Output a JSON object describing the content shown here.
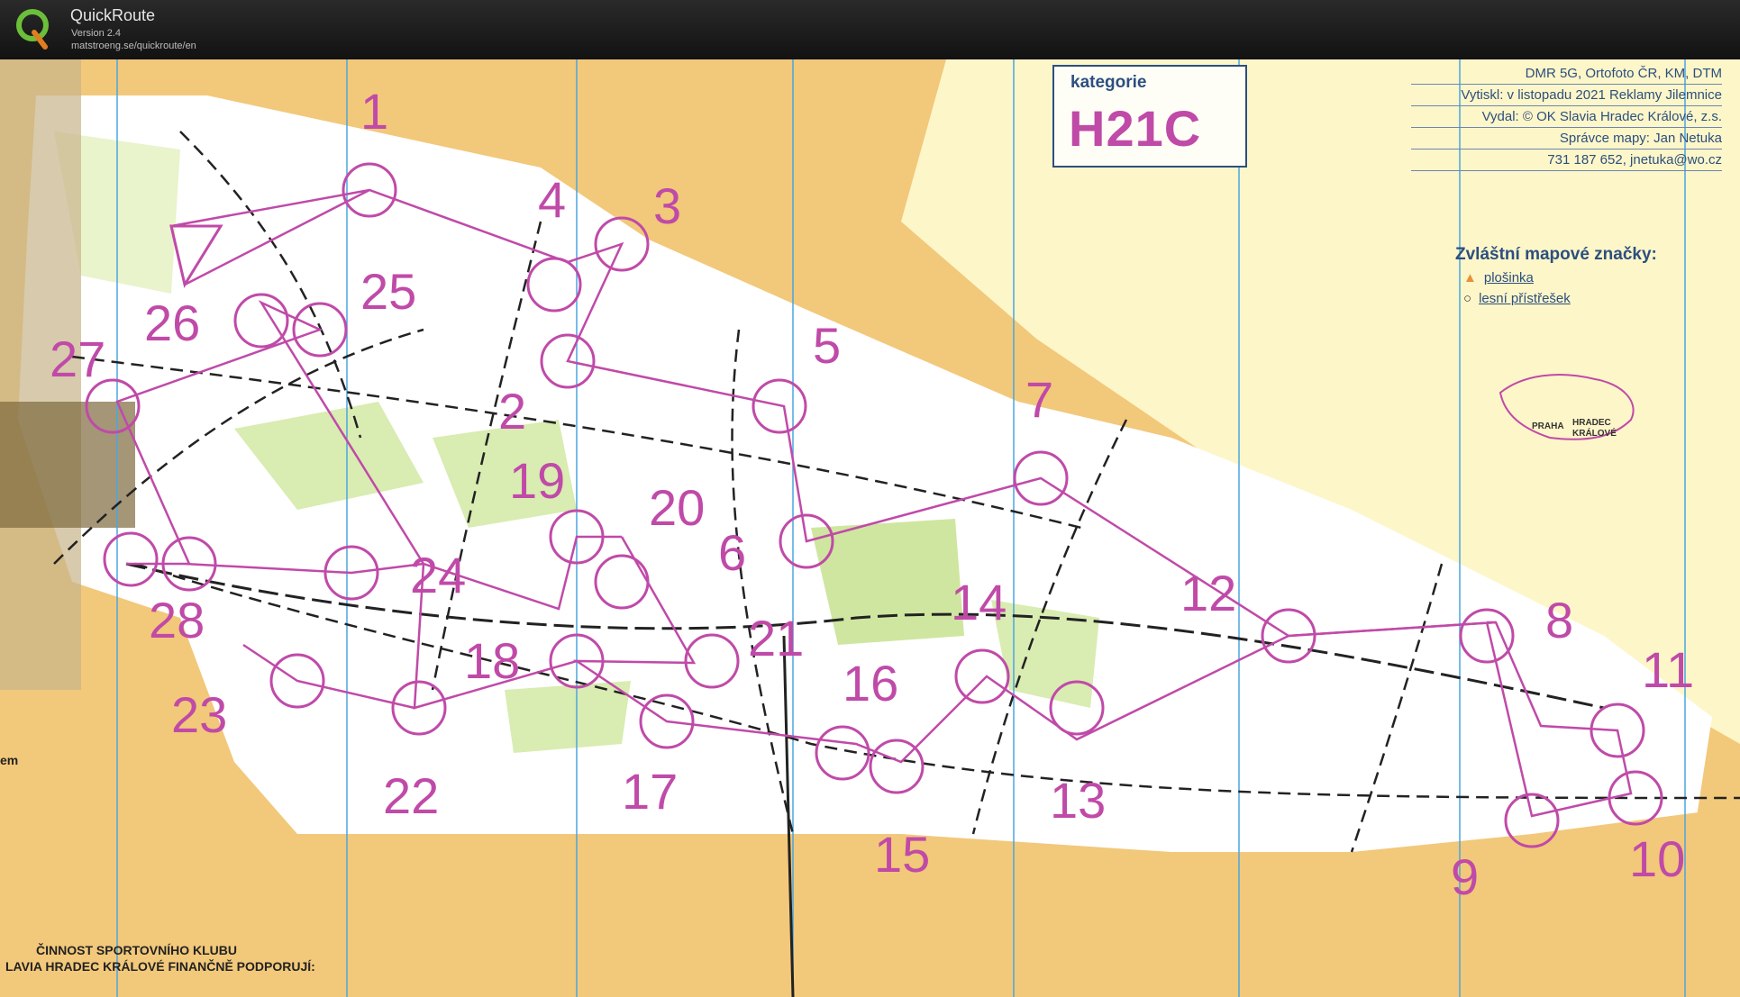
{
  "app": {
    "name": "QuickRoute",
    "version": "Version 2.4",
    "url": "matstroeng.se/quickroute/en"
  },
  "map": {
    "category_label": "kategorie",
    "category_value": "H21C",
    "info_lines": [
      "DMR 5G, Ortofoto ČR, KM, DTM",
      "Vytiskl: v listopadu 2021 Reklamy Jilemnice",
      "Vydal:      © OK Slavia Hradec Králové, z.s.",
      "Správce mapy:                    Jan Netuka",
      "731 187 652, jnetuka@wo.cz"
    ],
    "legend": {
      "title": "Zvláštní mapové značky:",
      "items": [
        {
          "symbol": "triangle-icon",
          "label": "plošinka"
        },
        {
          "symbol": "circle-icon",
          "label": "lesní přístřešek"
        }
      ]
    },
    "minimap": {
      "city1": "PRAHA",
      "city2": "HRADEC",
      "city3": "KRÁLOVÉ"
    },
    "footer_line1": "ČINNOST SPORTOVNÍHO KLUBU",
    "footer_line2": "LAVIA HRADEC KRÁLOVÉ FINANČNĚ PODPORUJÍ:",
    "edge_text": "em",
    "controls": [
      "1",
      "2",
      "3",
      "4",
      "5",
      "6",
      "7",
      "8",
      "9",
      "10",
      "11",
      "12",
      "13",
      "14",
      "15",
      "16",
      "17",
      "18",
      "19",
      "20",
      "21",
      "22",
      "23",
      "24",
      "25",
      "26",
      "27",
      "28"
    ]
  },
  "colors": {
    "course": "#c04aa8",
    "forest_open": "#f2c87a",
    "forest": "#ffffff",
    "green": "#cfe6a0",
    "grid": "#4aa6e0"
  }
}
